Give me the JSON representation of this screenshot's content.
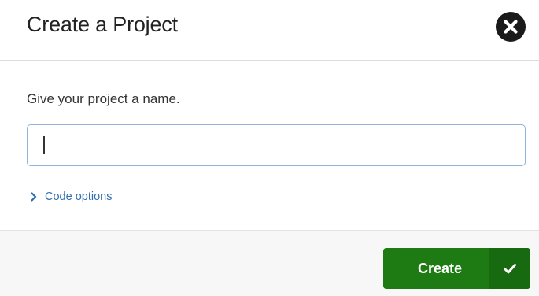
{
  "dialog": {
    "title": "Create a Project",
    "close_icon": "close-circle-icon"
  },
  "body": {
    "prompt": "Give your project a name.",
    "name_input": {
      "value": "",
      "placeholder": ""
    },
    "code_options": {
      "label": "Code options",
      "icon": "chevron-right-icon",
      "expanded": false
    }
  },
  "footer": {
    "create_button": {
      "label": "Create",
      "icon": "checkmark-icon"
    }
  },
  "colors": {
    "accent_link": "#2f6fad",
    "primary_button": "#1e7b14",
    "input_border": "#8fb3d6"
  }
}
